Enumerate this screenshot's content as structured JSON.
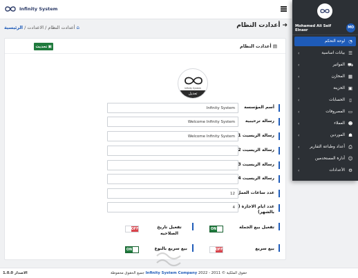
{
  "header": {
    "brand": "Infinity System",
    "menu_icon": "hamburger-icon"
  },
  "breadcrumb": {
    "home": "الرئيسية",
    "sep1": "/",
    "settings": "الاعدادت",
    "sep2": "/",
    "current": "أعدادت النظام"
  },
  "page": {
    "title": "أعدادت النظام",
    "back_icon": "arrow-right-icon"
  },
  "card": {
    "title": "أعدادت النظام",
    "update_label": "تحديث",
    "logo_caption": "Infinity System",
    "logo_edit_label": "تعديل"
  },
  "form": {
    "company_name": {
      "label": "أسم المؤسسة",
      "value": "Infinity System"
    },
    "welcome_message": {
      "label": "رسالة ترحيبية",
      "value": "Welcome Infinity System"
    },
    "receipt_1": {
      "label": "رسالة الريسيت 1",
      "value": "Welcome Infinity System"
    },
    "receipt_2": {
      "label": "رسالة الريسيت 2",
      "value": ""
    },
    "receipt_3": {
      "label": "رسالة الريسيت 3",
      "value": ""
    },
    "receipt_4": {
      "label": "رسالة الريسيت 4",
      "value": ""
    },
    "work_hours": {
      "label": "عدد ساعات العمل",
      "value": "12"
    },
    "vacation_days": {
      "label": "عدد ايام الاجازة ( بالشهر)",
      "value": "4"
    },
    "toggles": {
      "wholesale": {
        "label": "تفعيل بيع الجملة",
        "state": "ON"
      },
      "expiry": {
        "label": "تفعيل تاريخ الصلاحيه",
        "state": "OFF"
      },
      "quick_sale": {
        "label": "بيع سريع",
        "state": "OFF"
      },
      "quick_sale_type": {
        "label": "بيع سريع بالنوع",
        "state": "ON"
      }
    }
  },
  "sidebar": {
    "user_name": "Mohamed Ali Seif Elnasr",
    "user_initials": "MO",
    "items": [
      {
        "label": "لوحة التحكم",
        "icon": "dashboard-icon",
        "active": true
      },
      {
        "label": "بيانات اساسية",
        "icon": "list-icon"
      },
      {
        "label": "الفواتير",
        "icon": "cart-icon"
      },
      {
        "label": "المخازن",
        "icon": "warehouse-icon"
      },
      {
        "label": "الخزينة",
        "icon": "safe-icon"
      },
      {
        "label": "الحسابات",
        "icon": "document-icon"
      },
      {
        "label": "المصروفات",
        "icon": "wallet-icon"
      },
      {
        "label": "العملاء",
        "icon": "users-icon"
      },
      {
        "label": "الموردين",
        "icon": "suppliers-icon"
      },
      {
        "label": "أعداد وطباعة التقارير",
        "icon": "print-icon"
      },
      {
        "label": "أدارة المستخدمين",
        "icon": "user-manage-icon"
      },
      {
        "label": "الأعدادات",
        "icon": "settings-icon"
      }
    ]
  },
  "footer": {
    "version": "الاصدار 1.0.0",
    "copyright_prefix": "حقوق الملكية © 2011 - 2022",
    "company": "Infinity System Company",
    "copyright_suffix": "جميع الحقوق محفوظة"
  },
  "colors": {
    "primary": "#1e5bb8",
    "sidebar_bg": "#2c3035",
    "update_btn": "#1f7a3d",
    "toggle_on": "#1f7a3d",
    "toggle_off": "#d9434b"
  }
}
